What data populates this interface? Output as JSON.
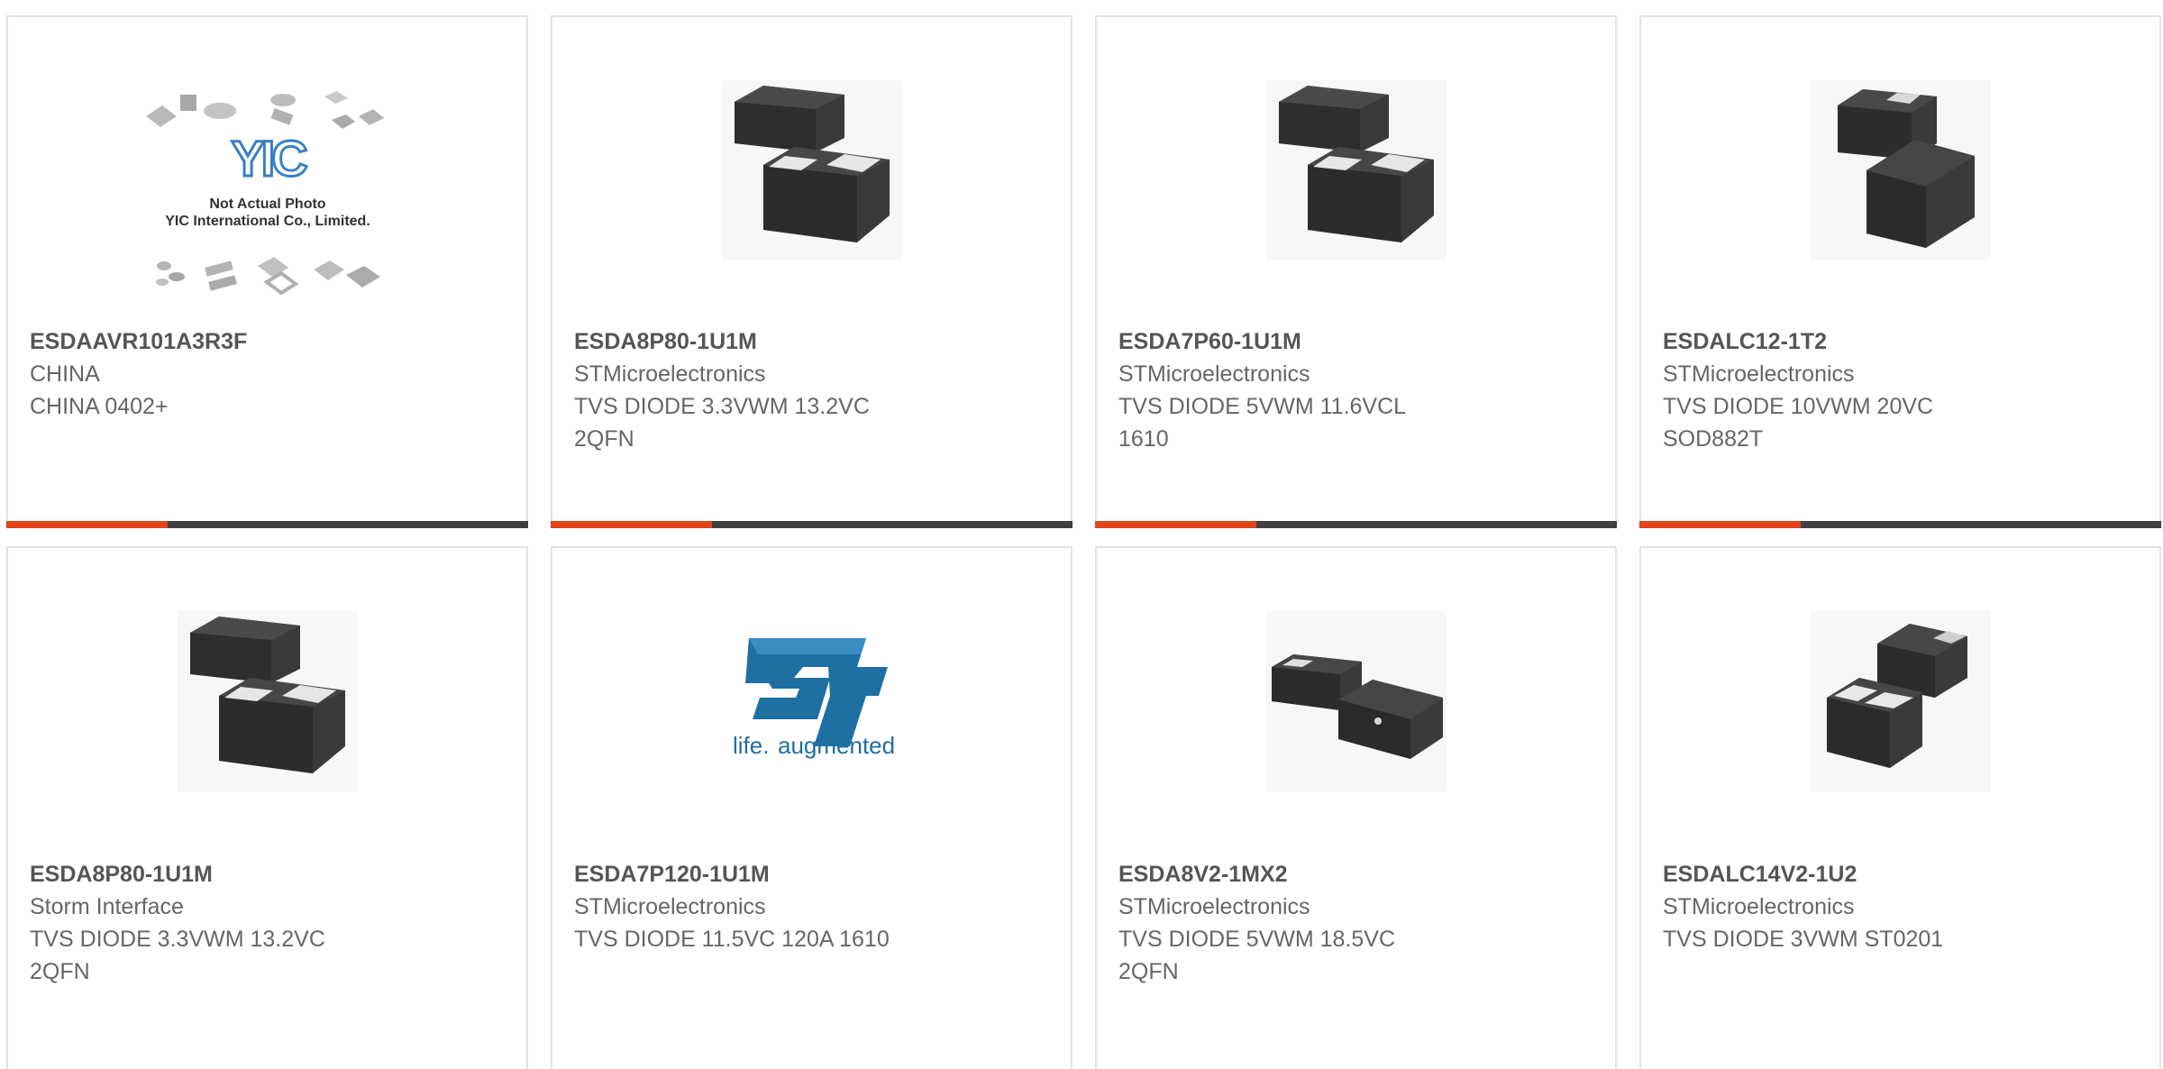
{
  "colors": {
    "accent": "#e2451b",
    "bar_dark": "#404040",
    "card_border": "#e3e3e3",
    "st_logo_blue": "#1f6fa3"
  },
  "products": [
    {
      "part": "ESDAAVR101A3R3F",
      "manufacturer": "CHINA",
      "line1": "CHINA 0402+",
      "line2": "",
      "image": "yic-placeholder",
      "image_text": {
        "brand": "YIC",
        "caption1": "Not Actual Photo",
        "caption2": "YIC International Co., Limited."
      },
      "bar_accent_fraction": 0.31
    },
    {
      "part": "ESDA8P80-1U1M",
      "manufacturer": "STMicroelectronics",
      "line1": "TVS DIODE 3.3VWM 13.2VC",
      "line2": "2QFN",
      "image": "chip-pair-qfn",
      "bar_accent_fraction": 0.31
    },
    {
      "part": "ESDA7P60-1U1M",
      "manufacturer": "STMicroelectronics",
      "line1": "TVS DIODE 5VWM 11.6VCL",
      "line2": "1610",
      "image": "chip-pair-qfn",
      "bar_accent_fraction": 0.31
    },
    {
      "part": "ESDALC12-1T2",
      "manufacturer": "STMicroelectronics",
      "line1": "TVS DIODE 10VWM 20VC",
      "line2": "SOD882T",
      "image": "chip-pair-sod",
      "bar_accent_fraction": 0.31
    },
    {
      "part": "ESDA8P80-1U1M",
      "manufacturer": "Storm Interface",
      "line1": "TVS DIODE 3.3VWM 13.2VC",
      "line2": "2QFN",
      "image": "chip-pair-qfn"
    },
    {
      "part": "ESDA7P120-1U1M",
      "manufacturer": "STMicroelectronics",
      "line1": "TVS DIODE 11.5VC 120A 1610",
      "line2": "",
      "image": "st-logo",
      "image_text": {
        "tagline_a": "life.",
        "tagline_b": "augmented"
      }
    },
    {
      "part": "ESDA8V2-1MX2",
      "manufacturer": "STMicroelectronics",
      "line1": "TVS DIODE 5VWM 18.5VC",
      "line2": "2QFN",
      "image": "chip-pair-small"
    },
    {
      "part": "ESDALC14V2-1U2",
      "manufacturer": "STMicroelectronics",
      "line1": "TVS DIODE 3VWM ST0201",
      "line2": "",
      "image": "chip-pair-sod-rev"
    }
  ]
}
